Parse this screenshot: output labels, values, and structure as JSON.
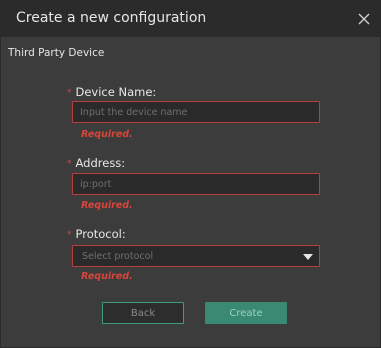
{
  "dialog": {
    "title": "Create a new configuration",
    "subtitle": "Third Party Device"
  },
  "form": {
    "required_marker": "*",
    "device_name": {
      "label": "Device Name:",
      "placeholder": "Input the device name",
      "value": "",
      "error": "Required."
    },
    "address": {
      "label": "Address:",
      "placeholder": "ip:port",
      "value": "",
      "error": "Required."
    },
    "protocol": {
      "label": "Protocol:",
      "placeholder": "Select protocol",
      "error": "Required."
    }
  },
  "buttons": {
    "back": "Back",
    "create": "Create"
  },
  "icons": {
    "close": "close-icon",
    "dropdown": "caret-down-icon"
  },
  "colors": {
    "accent": "#3a8a73",
    "error": "#d9453a",
    "field_border_error": "#b5403a",
    "background": "#3c3c3c",
    "titlebar": "#2b2b2b"
  }
}
